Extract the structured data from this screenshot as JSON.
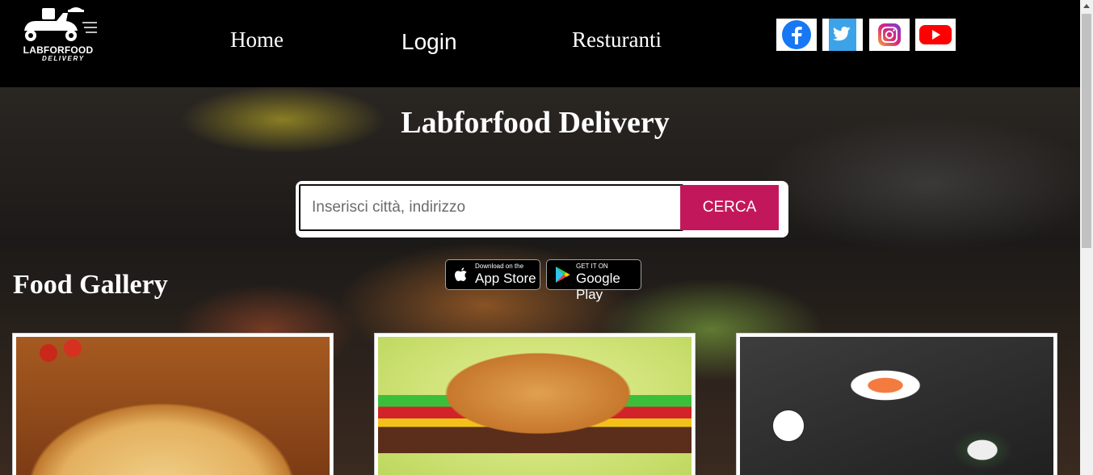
{
  "header": {
    "logo": {
      "name": "LABFORFOOD",
      "sub": "DELIVERY"
    },
    "nav": {
      "home": "Home",
      "login": "Login",
      "restaurants": "Resturanti"
    },
    "social": [
      {
        "name": "facebook-icon",
        "color": "#1877f2"
      },
      {
        "name": "twitter-icon",
        "color": "#1da1f2"
      },
      {
        "name": "instagram-icon",
        "color": "#c13584"
      },
      {
        "name": "youtube-icon",
        "color": "#ff0000"
      }
    ]
  },
  "hero": {
    "title": "Labforfood Delivery",
    "search": {
      "placeholder": "Inserisci città, indirizzo",
      "value": "",
      "button": "CERCA"
    },
    "badges": {
      "apple": {
        "small": "Download on the",
        "big": "App Store"
      },
      "google": {
        "small": "GET IT ON",
        "big": "Google Play"
      }
    }
  },
  "gallery": {
    "title": "Food Gallery",
    "items": [
      {
        "name": "pizza"
      },
      {
        "name": "burger"
      },
      {
        "name": "sushi"
      }
    ]
  },
  "colors": {
    "header_bg": "#000000",
    "accent": "#c2185b",
    "text": "#ffffff"
  }
}
